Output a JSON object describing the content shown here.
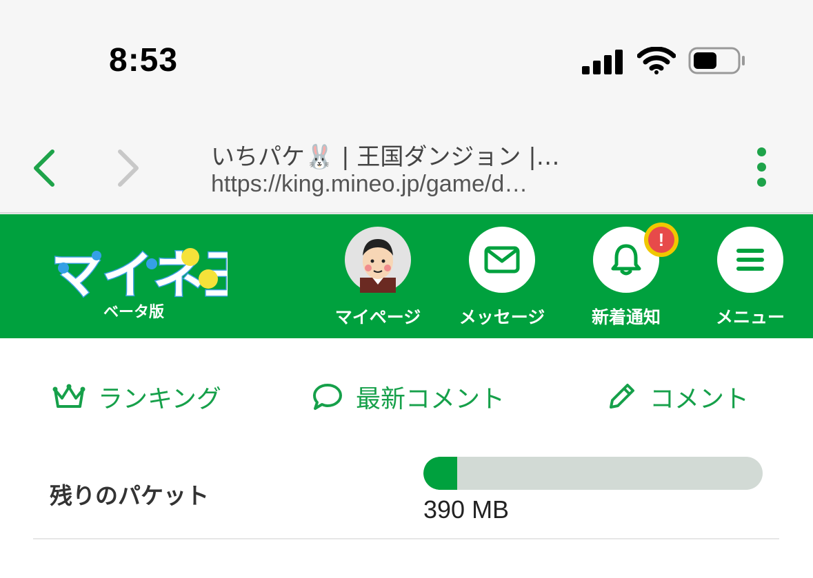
{
  "status_bar": {
    "time": "8:53",
    "battery_level": 0.55
  },
  "browser": {
    "page_title": "いちパケ🐰 | 王国ダンジョン |…",
    "url": "https://king.mineo.jp/game/d…"
  },
  "header": {
    "logo_text": "マイネ王",
    "beta_label": "ベータ版",
    "nav": [
      {
        "label": "マイページ",
        "icon": "avatar"
      },
      {
        "label": "メッセージ",
        "icon": "mail-icon"
      },
      {
        "label": "新着通知",
        "icon": "bell-icon",
        "badge": "!"
      },
      {
        "label": "メニュー",
        "icon": "hamburger-icon"
      }
    ]
  },
  "quick_links": [
    {
      "label": "ランキング",
      "icon": "crown-icon"
    },
    {
      "label": "最新コメント",
      "icon": "speech-bubble-icon"
    },
    {
      "label": "コメント",
      "icon": "pencil-icon"
    }
  ],
  "packet": {
    "label": "残りのパケット",
    "value": "390 MB",
    "fill_fraction": 0.1
  },
  "colors": {
    "brand_green": "#00a13e",
    "link_green": "#16a04a",
    "badge_red": "#e74a4a",
    "badge_yellow": "#f0c800"
  }
}
